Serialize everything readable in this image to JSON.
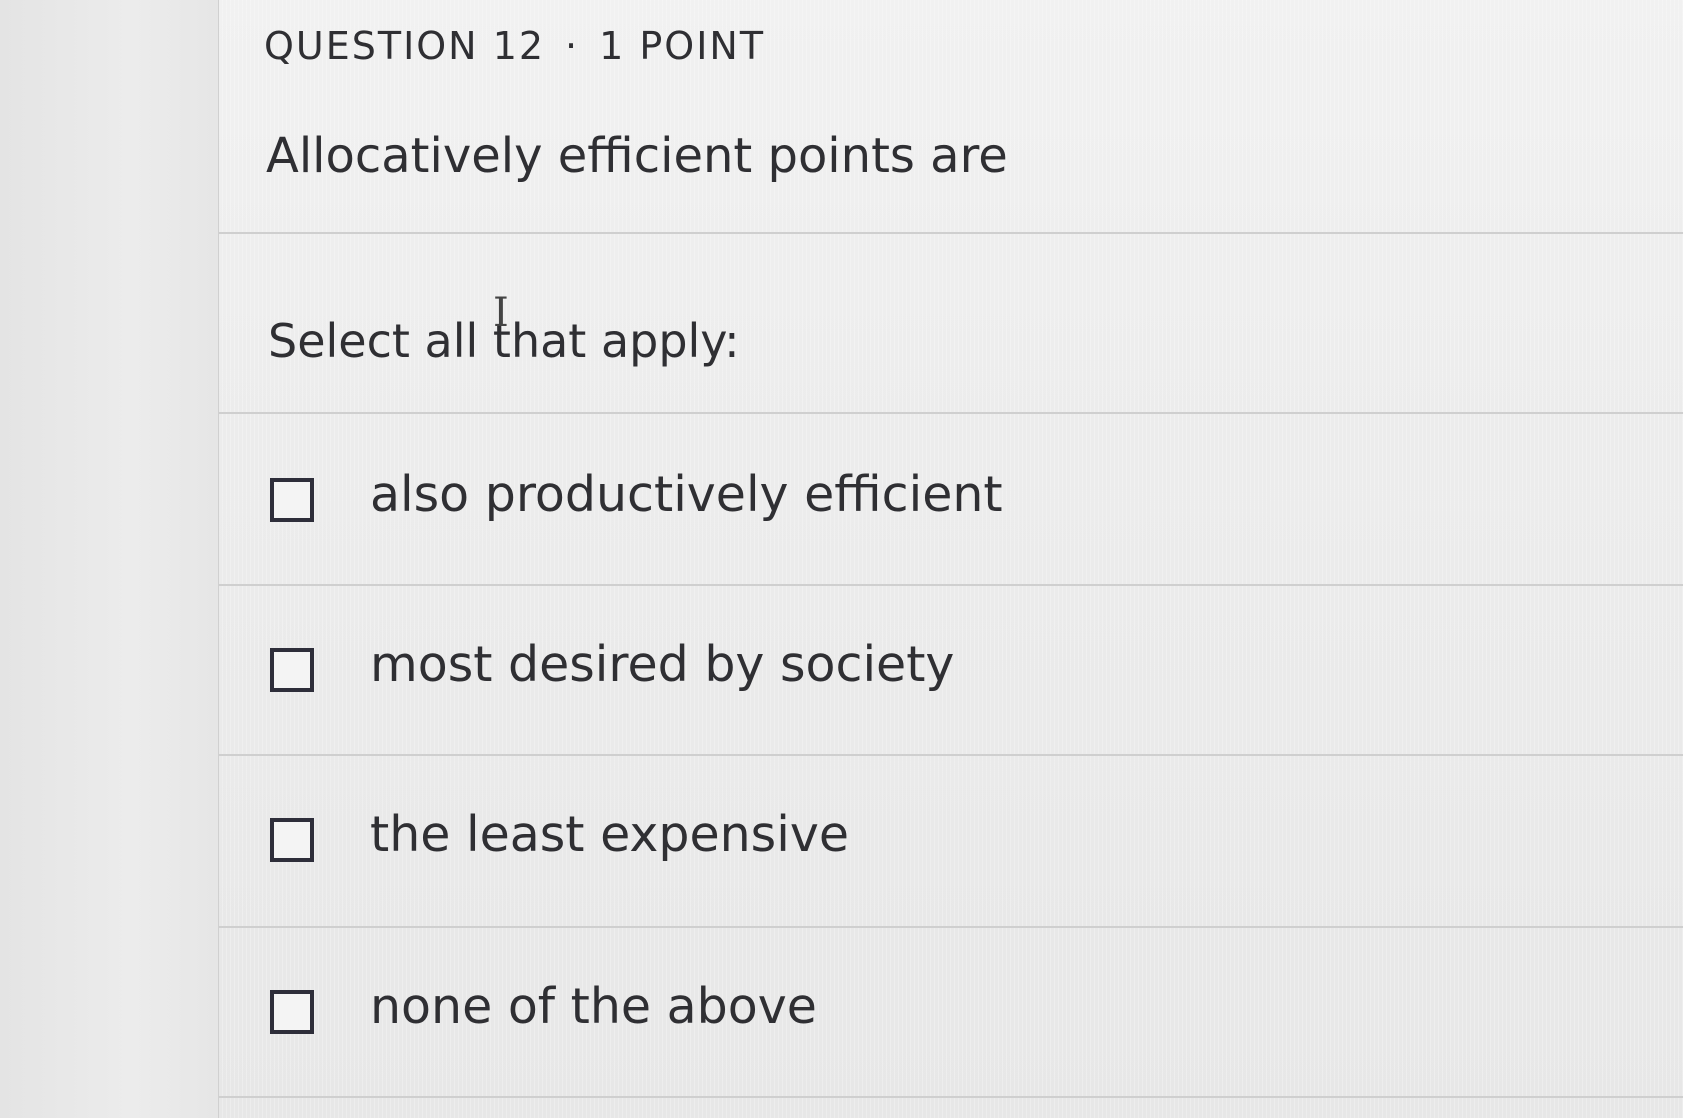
{
  "question": {
    "header_number": "QUESTION 12",
    "header_separator": "·",
    "header_points": "1 POINT",
    "prompt": "Allocatively efficient points are",
    "instruction": "Select all that apply:"
  },
  "options": [
    {
      "label": "also productively efficient",
      "checked": false
    },
    {
      "label": "most desired by society",
      "checked": false
    },
    {
      "label": "the least expensive",
      "checked": false
    },
    {
      "label": "none of the above",
      "checked": false
    }
  ],
  "icons": {
    "cursor": "text-cursor-icon"
  }
}
